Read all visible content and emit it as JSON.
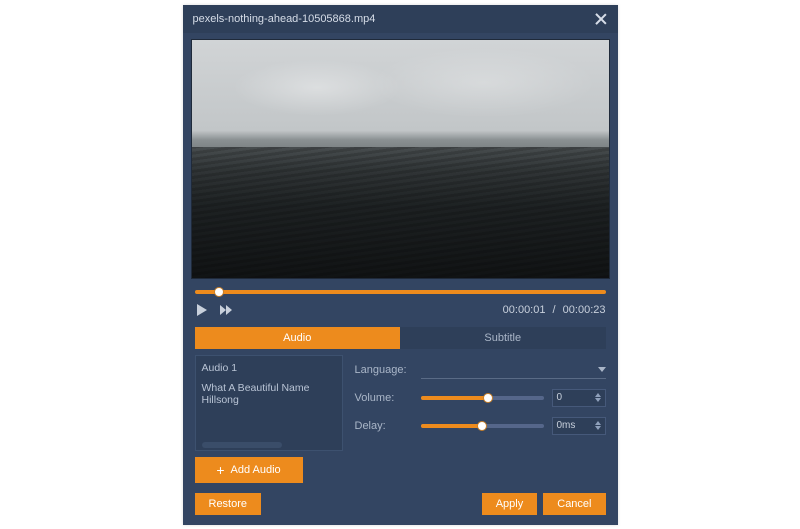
{
  "header": {
    "filename": "pexels-nothing-ahead-10505868.mp4"
  },
  "playback": {
    "seek_percent": 6,
    "current_time": "00:00:01",
    "duration": "00:00:23"
  },
  "tabs": {
    "audio_label": "Audio",
    "subtitle_label": "Subtitle",
    "active": "audio"
  },
  "audio_list": {
    "items": [
      "Audio 1",
      "What A Beautiful Name  Hillsong"
    ]
  },
  "settings": {
    "language": {
      "label": "Language:",
      "value": ""
    },
    "volume": {
      "label": "Volume:",
      "percent": 55,
      "value": "0"
    },
    "delay": {
      "label": "Delay:",
      "percent": 50,
      "value": "0ms"
    }
  },
  "buttons": {
    "add_audio": "Add Audio",
    "restore": "Restore",
    "apply": "Apply",
    "cancel": "Cancel"
  },
  "colors": {
    "accent": "#ed8b1d",
    "panel": "#334562",
    "panel_dark": "#2e3f59"
  }
}
